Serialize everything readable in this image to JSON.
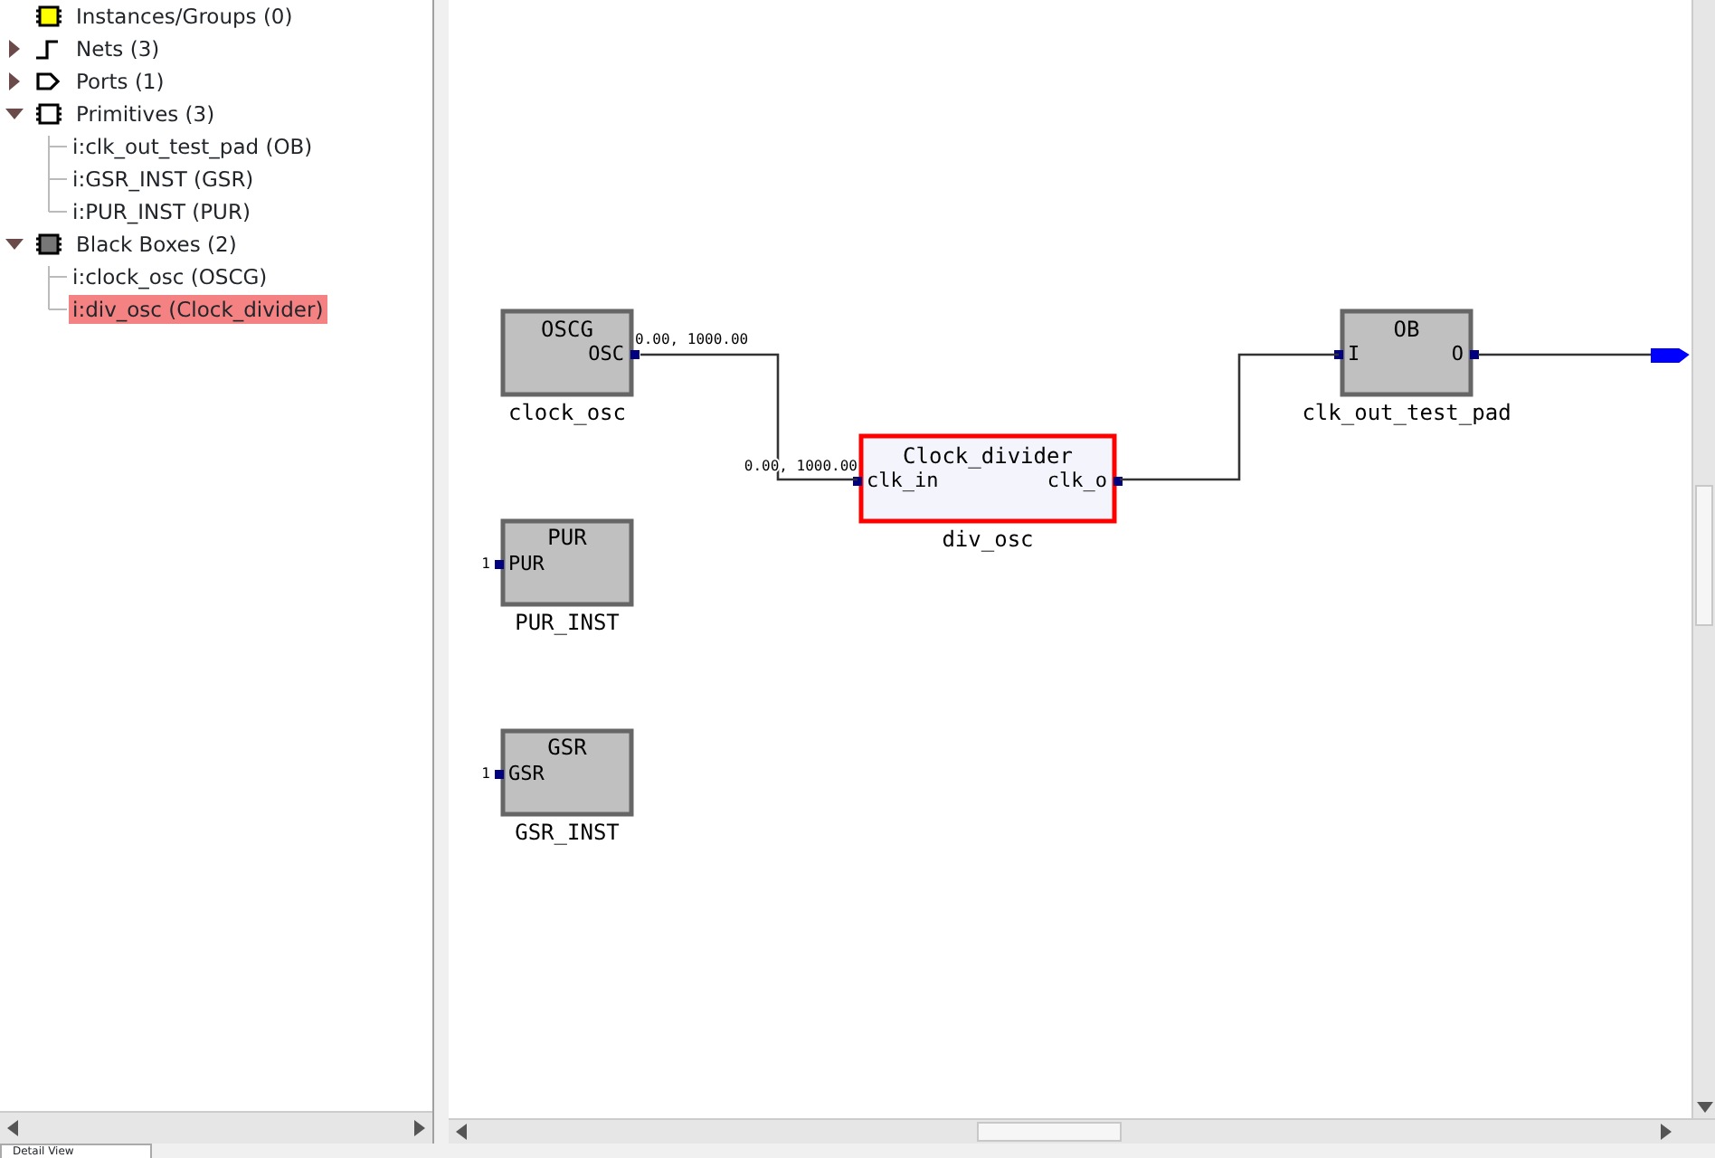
{
  "tree": [
    {
      "label": "Instances/Groups (0)",
      "kind": "instance"
    },
    {
      "label": "Nets (3)",
      "kind": "net",
      "expanded": false
    },
    {
      "label": "Ports (1)",
      "kind": "port",
      "expanded": false
    },
    {
      "label": "Primitives (3)",
      "kind": "primitive",
      "expanded": true,
      "children": [
        {
          "label": "i:clk_out_test_pad (OB)",
          "selected": false
        },
        {
          "label": "i:GSR_INST (GSR)",
          "selected": false
        },
        {
          "label": "i:PUR_INST (PUR)",
          "selected": false
        }
      ]
    },
    {
      "label": "Black Boxes (2)",
      "kind": "blackbox",
      "expanded": true,
      "children": [
        {
          "label": "i:clock_osc (OSCG)",
          "selected": false
        },
        {
          "label": "i:div_osc (Clock_divider)",
          "selected": true
        }
      ]
    }
  ],
  "schematic": {
    "blocks": [
      {
        "title": "OSCG",
        "instance": "clock_osc",
        "selected": false,
        "ports": [
          {
            "name": "OSC",
            "kind": "output"
          }
        ]
      },
      {
        "title": "Clock_divider",
        "instance": "div_osc",
        "selected": true,
        "ports": [
          {
            "name": "clk_in",
            "kind": "input"
          },
          {
            "name": "clk_o",
            "kind": "output"
          }
        ]
      },
      {
        "title": "OB",
        "instance": "clk_out_test_pad",
        "selected": false,
        "ports": [
          {
            "name": "I",
            "kind": "input"
          },
          {
            "name": "O",
            "kind": "output"
          }
        ]
      },
      {
        "title": "PUR",
        "instance": "PUR_INST",
        "selected": false,
        "ports": [
          {
            "name": "PUR",
            "kind": "input",
            "tie": "1"
          }
        ]
      },
      {
        "title": "GSR",
        "instance": "GSR_INST",
        "selected": false,
        "ports": [
          {
            "name": "GSR",
            "kind": "input",
            "tie": "1"
          }
        ]
      }
    ],
    "net_labels": [
      "0.00, 1000.00",
      "0.00, 1000.00"
    ]
  },
  "bottom_tabs": [
    {
      "label": "Detail View",
      "selected": true
    }
  ]
}
